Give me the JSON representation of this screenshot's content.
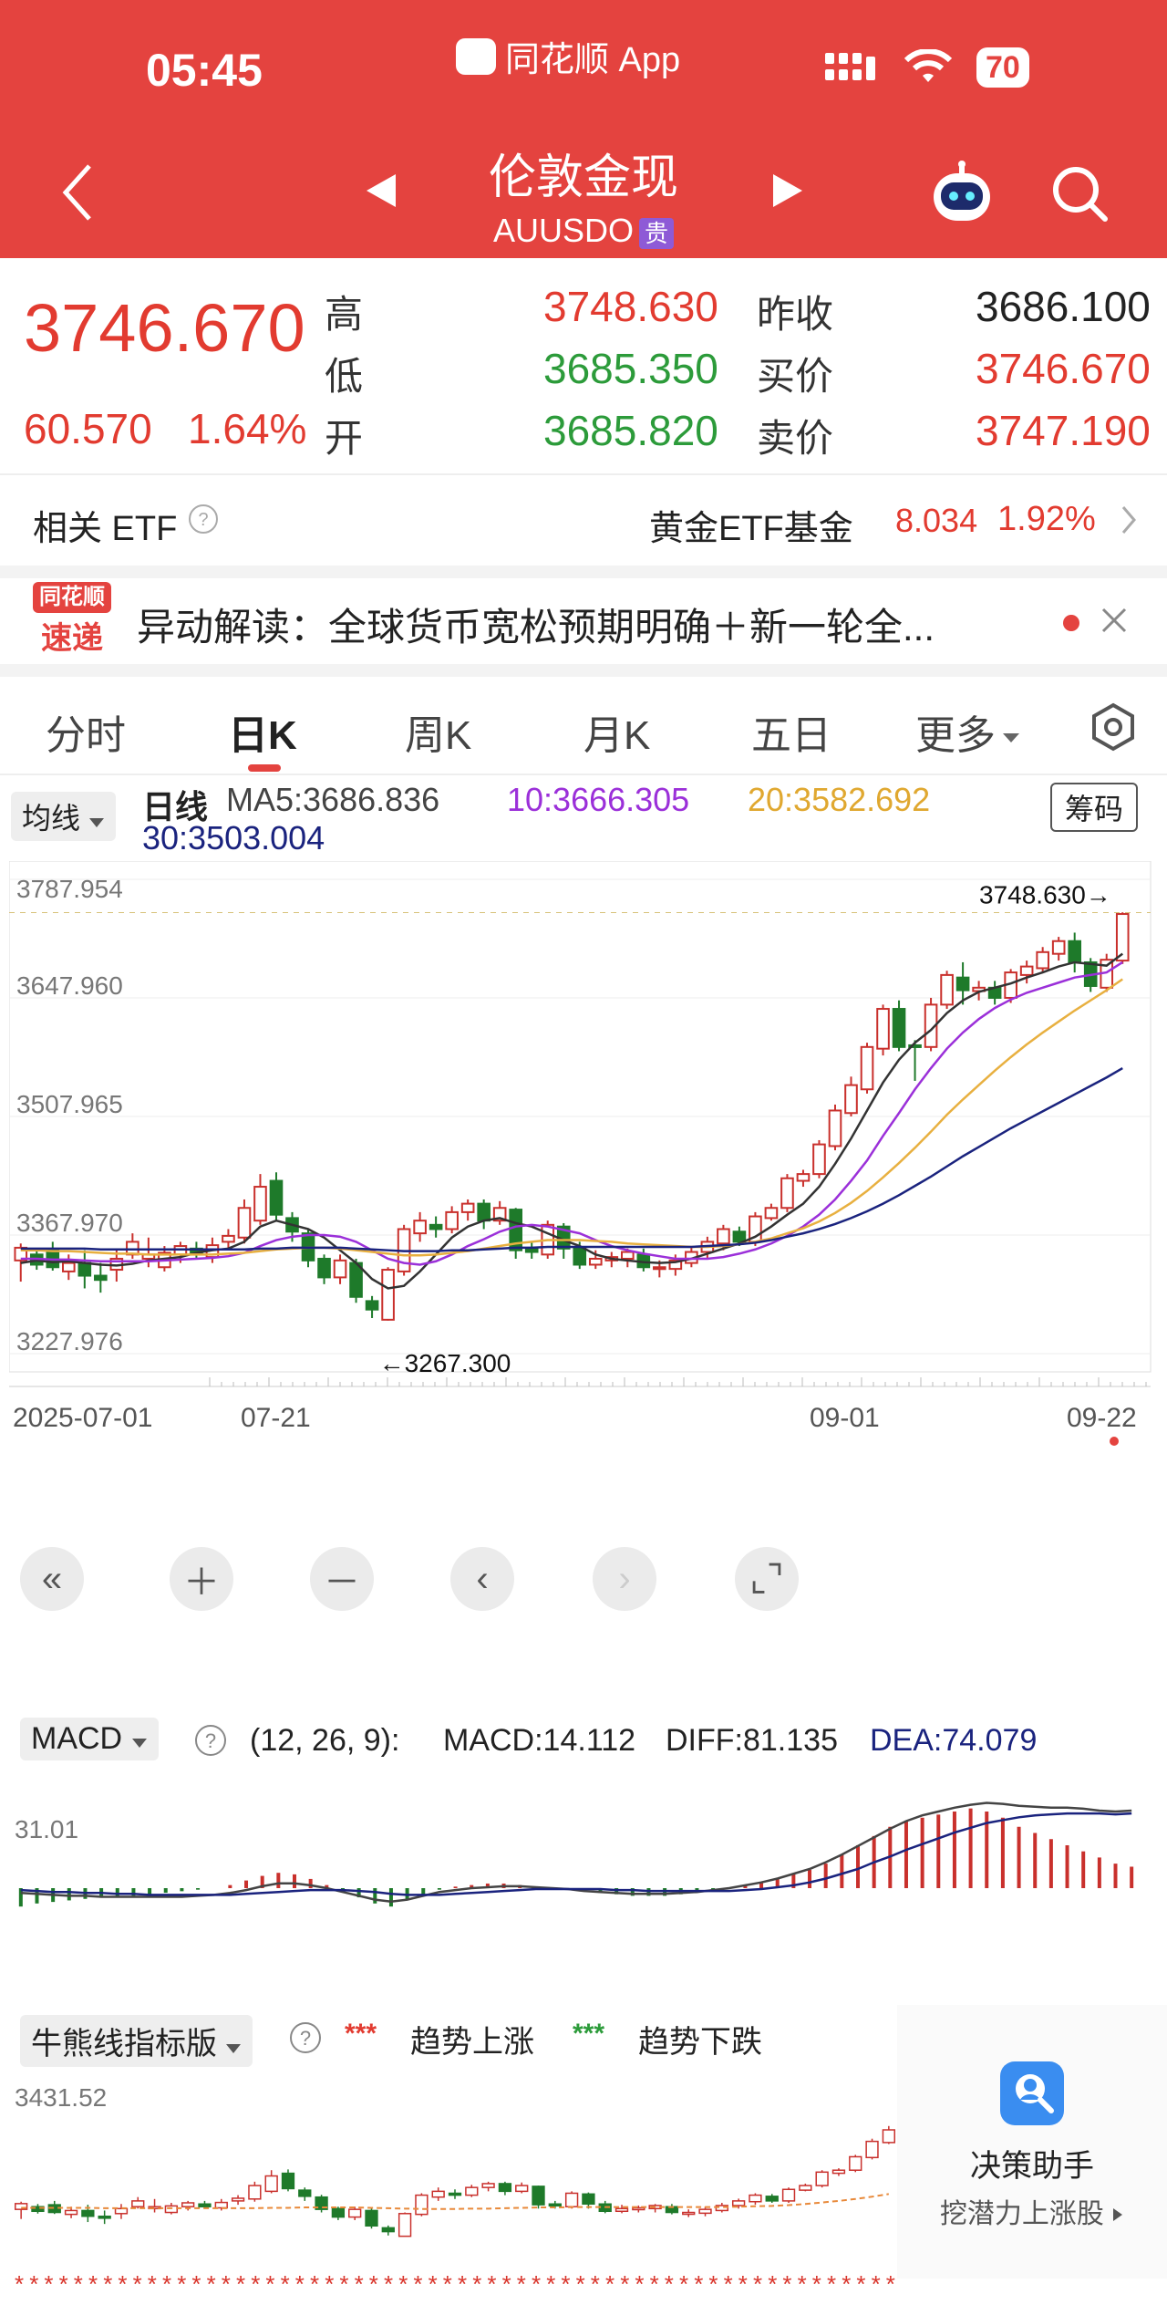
{
  "status": {
    "time": "05:45",
    "app": "同花顺 App",
    "battery": "70"
  },
  "header": {
    "title": "伦敦金现",
    "subtitle": "AUUSDO",
    "badge": "贵"
  },
  "quote": {
    "price": "3746.670",
    "change": "60.570",
    "change_pct": "1.64%",
    "high_label": "高",
    "high": "3748.630",
    "low_label": "低",
    "low": "3685.350",
    "open_label": "开",
    "open": "3685.820",
    "prev_close_label": "昨收",
    "prev_close": "3686.100",
    "bid_label": "买价",
    "bid": "3746.670",
    "ask_label": "卖价",
    "ask": "3747.190"
  },
  "etf": {
    "label": "相关 ETF",
    "name": "黄金ETF基金",
    "price": "8.034",
    "pct": "1.92%"
  },
  "news": {
    "logo_top": "同花顺",
    "logo_bottom": "速递",
    "text": "异动解读：全球货币宽松预期明确＋新一轮全..."
  },
  "tabs": [
    "分时",
    "日K",
    "周K",
    "月K",
    "五日",
    "更多"
  ],
  "ma": {
    "selector": "均线",
    "label": "日线",
    "ma5": "MA5:3686.836",
    "ma10": "10:3666.305",
    "ma20": "20:3582.692",
    "ma30": "30:3503.004",
    "chips_button": "筹码"
  },
  "colors": {
    "up": "#c9302c",
    "down": "#1e7a2a",
    "ma5": "#333333",
    "ma10": "#9b30d9",
    "ma20": "#e8b040",
    "ma30": "#1a237e"
  },
  "chart_data": [
    {
      "type": "candlestick",
      "title": "日线",
      "ylim": [
        3227.976,
        3787.954
      ],
      "y_ticks": [
        "3787.954",
        "3647.960",
        "3507.965",
        "3367.970",
        "3227.976"
      ],
      "x_labels": [
        "2025-07-01",
        "07-21",
        "09-01",
        "09-22"
      ],
      "max_label": "3748.630→",
      "min_label": "←3267.300",
      "candles": [
        [
          3338,
          3353,
          3313,
          3358
        ],
        [
          3345,
          3333,
          3327,
          3352
        ],
        [
          3350,
          3330,
          3326,
          3360
        ],
        [
          3325,
          3335,
          3315,
          3345
        ],
        [
          3335,
          3320,
          3305,
          3350
        ],
        [
          3320,
          3315,
          3300,
          3335
        ],
        [
          3327,
          3340,
          3313,
          3352
        ],
        [
          3345,
          3360,
          3340,
          3370
        ],
        [
          3340,
          3345,
          3330,
          3365
        ],
        [
          3330,
          3347,
          3325,
          3355
        ],
        [
          3345,
          3355,
          3335,
          3360
        ],
        [
          3352,
          3345,
          3340,
          3360
        ],
        [
          3342,
          3356,
          3335,
          3365
        ],
        [
          3360,
          3367,
          3350,
          3375
        ],
        [
          3365,
          3400,
          3358,
          3410
        ],
        [
          3385,
          3425,
          3380,
          3440
        ],
        [
          3432,
          3392,
          3385,
          3442
        ],
        [
          3388,
          3372,
          3360,
          3395
        ],
        [
          3370,
          3338,
          3330,
          3376
        ],
        [
          3340,
          3318,
          3310,
          3345
        ],
        [
          3318,
          3338,
          3310,
          3345
        ],
        [
          3335,
          3295,
          3288,
          3340
        ],
        [
          3290,
          3280,
          3270,
          3296
        ],
        [
          3268,
          3327,
          3267,
          3330
        ],
        [
          3325,
          3375,
          3320,
          3380
        ],
        [
          3370,
          3385,
          3360,
          3395
        ],
        [
          3380,
          3375,
          3365,
          3390
        ],
        [
          3375,
          3395,
          3370,
          3402
        ],
        [
          3395,
          3405,
          3385,
          3410
        ],
        [
          3405,
          3385,
          3375,
          3410
        ],
        [
          3385,
          3400,
          3380,
          3408
        ],
        [
          3398,
          3350,
          3340,
          3400
        ],
        [
          3352,
          3348,
          3340,
          3360
        ],
        [
          3345,
          3380,
          3340,
          3385
        ],
        [
          3378,
          3352,
          3340,
          3382
        ],
        [
          3352,
          3333,
          3328,
          3360
        ],
        [
          3333,
          3340,
          3328,
          3350
        ],
        [
          3338,
          3342,
          3330,
          3348
        ],
        [
          3340,
          3348,
          3330,
          3352
        ],
        [
          3345,
          3330,
          3325,
          3352
        ],
        [
          3330,
          3330,
          3318,
          3338
        ],
        [
          3328,
          3338,
          3320,
          3345
        ],
        [
          3335,
          3348,
          3330,
          3355
        ],
        [
          3348,
          3360,
          3340,
          3366
        ],
        [
          3358,
          3375,
          3350,
          3380
        ],
        [
          3372,
          3360,
          3355,
          3378
        ],
        [
          3360,
          3390,
          3355,
          3395
        ],
        [
          3388,
          3400,
          3385,
          3405
        ],
        [
          3400,
          3435,
          3395,
          3440
        ],
        [
          3432,
          3440,
          3425,
          3445
        ],
        [
          3440,
          3475,
          3435,
          3480
        ],
        [
          3473,
          3515,
          3468,
          3522
        ],
        [
          3512,
          3545,
          3508,
          3555
        ],
        [
          3540,
          3590,
          3535,
          3595
        ],
        [
          3588,
          3635,
          3580,
          3640
        ],
        [
          3635,
          3590,
          3585,
          3645
        ],
        [
          3592,
          3590,
          3550,
          3598
        ],
        [
          3590,
          3640,
          3585,
          3648
        ],
        [
          3640,
          3675,
          3635,
          3680
        ],
        [
          3672,
          3657,
          3640,
          3690
        ],
        [
          3656,
          3660,
          3645,
          3668
        ],
        [
          3660,
          3648,
          3640,
          3668
        ],
        [
          3648,
          3678,
          3642,
          3682
        ],
        [
          3675,
          3685,
          3665,
          3692
        ],
        [
          3683,
          3702,
          3678,
          3708
        ],
        [
          3700,
          3715,
          3692,
          3720
        ],
        [
          3715,
          3690,
          3678,
          3725
        ],
        [
          3690,
          3662,
          3655,
          3695
        ],
        [
          3660,
          3693,
          3655,
          3700
        ],
        [
          3692,
          3747,
          3688,
          3749
        ]
      ],
      "ma5": [
        3335,
        3338,
        3336,
        3337,
        3335,
        3333,
        3332,
        3334,
        3338,
        3340,
        3342,
        3347,
        3350,
        3352,
        3360,
        3378,
        3385,
        3380,
        3375,
        3365,
        3350,
        3335,
        3316,
        3305,
        3308,
        3325,
        3345,
        3365,
        3378,
        3385,
        3388,
        3382,
        3378,
        3370,
        3362,
        3355,
        3345,
        3340,
        3338,
        3336,
        3335,
        3336,
        3340,
        3346,
        3352,
        3358,
        3366,
        3378,
        3392,
        3405,
        3425,
        3452,
        3482,
        3515,
        3548,
        3575,
        3595,
        3610,
        3630,
        3645,
        3655,
        3660,
        3665,
        3672,
        3678,
        3685,
        3690,
        3688,
        3686,
        3700
      ],
      "ma10": [
        3340,
        3340,
        3339,
        3339,
        3338,
        3337,
        3337,
        3337,
        3337,
        3338,
        3339,
        3340,
        3341,
        3343,
        3347,
        3355,
        3362,
        3366,
        3368,
        3368,
        3366,
        3360,
        3350,
        3340,
        3335,
        3333,
        3337,
        3345,
        3355,
        3363,
        3372,
        3378,
        3380,
        3378,
        3374,
        3370,
        3362,
        3355,
        3350,
        3346,
        3343,
        3340,
        3340,
        3340,
        3342,
        3346,
        3351,
        3358,
        3367,
        3378,
        3392,
        3410,
        3432,
        3456,
        3485,
        3512,
        3540,
        3565,
        3588,
        3607,
        3623,
        3636,
        3646,
        3654,
        3660,
        3666,
        3672,
        3675,
        3678,
        3690
      ],
      "ma20": [
        3350,
        3350,
        3349,
        3349,
        3348,
        3347,
        3346,
        3346,
        3345,
        3345,
        3345,
        3345,
        3345,
        3346,
        3347,
        3349,
        3351,
        3352,
        3353,
        3353,
        3352,
        3350,
        3348,
        3346,
        3344,
        3344,
        3345,
        3347,
        3349,
        3352,
        3355,
        3358,
        3360,
        3362,
        3362,
        3362,
        3361,
        3360,
        3358,
        3357,
        3356,
        3355,
        3354,
        3354,
        3355,
        3357,
        3360,
        3364,
        3370,
        3376,
        3384,
        3394,
        3406,
        3420,
        3436,
        3453,
        3471,
        3490,
        3510,
        3528,
        3545,
        3562,
        3578,
        3593,
        3607,
        3620,
        3633,
        3645,
        3657,
        3670
      ],
      "ma30": [
        3352,
        3352,
        3352,
        3352,
        3352,
        3351,
        3351,
        3351,
        3351,
        3351,
        3351,
        3351,
        3351,
        3351,
        3351,
        3352,
        3352,
        3353,
        3353,
        3353,
        3353,
        3352,
        3351,
        3350,
        3349,
        3349,
        3349,
        3350,
        3350,
        3351,
        3352,
        3353,
        3353,
        3354,
        3354,
        3354,
        3354,
        3354,
        3354,
        3354,
        3354,
        3354,
        3354,
        3355,
        3356,
        3357,
        3359,
        3362,
        3366,
        3370,
        3375,
        3381,
        3388,
        3396,
        3405,
        3415,
        3426,
        3437,
        3449,
        3461,
        3472,
        3483,
        3494,
        3504,
        3514,
        3524,
        3534,
        3544,
        3554,
        3565
      ]
    },
    {
      "type": "bar",
      "title": "MACD",
      "params": "(12, 26, 9):",
      "macd_label": "MACD:14.112",
      "diff_label": "DIFF:81.135",
      "dea_label": "DEA:74.079",
      "y_tick": "31.01",
      "histogram": [
        -12,
        -10,
        -9,
        -8,
        -7,
        -6,
        -6,
        -5,
        -4,
        -3,
        -2,
        -1,
        0,
        2,
        5,
        8,
        10,
        9,
        6,
        2,
        -2,
        -6,
        -10,
        -12,
        -8,
        -4,
        -1,
        1,
        2,
        3,
        3,
        2,
        1,
        0,
        -1,
        -2,
        -3,
        -4,
        -5,
        -5,
        -5,
        -4,
        -3,
        -2,
        0,
        2,
        4,
        6,
        9,
        12,
        16,
        22,
        28,
        34,
        40,
        44,
        46,
        48,
        50,
        52,
        50,
        46,
        40,
        36,
        32,
        28,
        24,
        20,
        16,
        14
      ],
      "diff": [
        -5,
        -6,
        -7,
        -8,
        -8,
        -9,
        -9,
        -9,
        -9,
        -9,
        -9,
        -8,
        -7,
        -5,
        -2,
        2,
        5,
        5,
        3,
        0,
        -4,
        -8,
        -12,
        -14,
        -12,
        -8,
        -4,
        -2,
        0,
        1,
        2,
        2,
        1,
        0,
        -1,
        -3,
        -4,
        -5,
        -6,
        -6,
        -6,
        -5,
        -4,
        -2,
        0,
        3,
        6,
        10,
        15,
        20,
        27,
        35,
        44,
        53,
        62,
        70,
        76,
        80,
        84,
        87,
        89,
        88,
        86,
        85,
        84,
        84,
        83,
        81,
        80,
        81
      ],
      "dea": [
        -2,
        -3,
        -4,
        -4,
        -5,
        -5,
        -6,
        -6,
        -7,
        -7,
        -7,
        -7,
        -7,
        -7,
        -6,
        -5,
        -4,
        -3,
        -2,
        -2,
        -2,
        -3,
        -4,
        -6,
        -7,
        -7,
        -7,
        -6,
        -5,
        -4,
        -3,
        -2,
        -1,
        -1,
        -1,
        -1,
        -1,
        -2,
        -2,
        -3,
        -3,
        -3,
        -3,
        -3,
        -3,
        -2,
        -1,
        1,
        3,
        6,
        10,
        15,
        20,
        27,
        33,
        40,
        46,
        52,
        58,
        63,
        68,
        71,
        74,
        76,
        77,
        78,
        78,
        78,
        77,
        78
      ]
    }
  ],
  "macd_panel": {
    "selector": "MACD"
  },
  "bull_panel": {
    "selector": "牛熊线指标版",
    "up_label": "趋势上涨",
    "down_label": "趋势下跌",
    "dots": "***",
    "y_tick": "3431.52"
  },
  "assistant": {
    "title": "决策助手",
    "subtitle": "挖潜力上涨股"
  }
}
